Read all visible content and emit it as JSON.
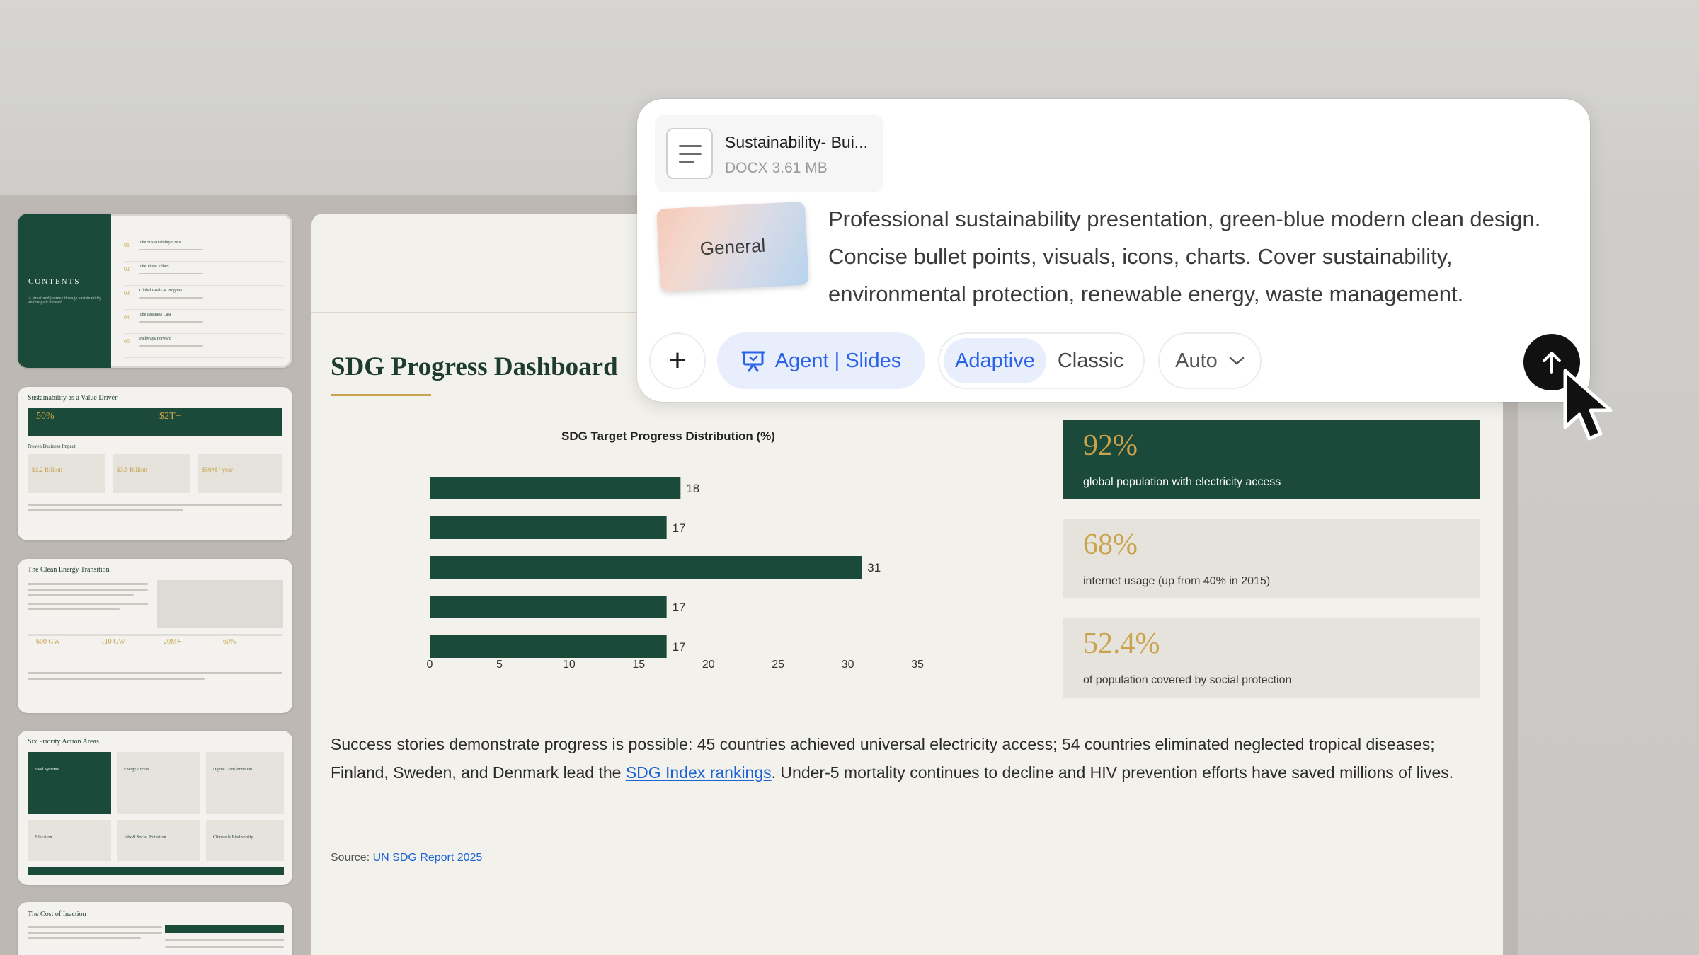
{
  "thumbnails": [
    {
      "title": "CONTENTS",
      "subtitle": "A structured journey through sustainability and its path forward",
      "items": [
        {
          "num": "01",
          "label": "The Sustainability Crisis"
        },
        {
          "num": "02",
          "label": "The Three Pillars"
        },
        {
          "num": "03",
          "label": "Global Goals & Progress"
        },
        {
          "num": "04",
          "label": "The Business Case"
        },
        {
          "num": "05",
          "label": "Pathways Forward"
        }
      ]
    },
    {
      "title": "Sustainability as a Value Driver",
      "stats": [
        "50%",
        "$2T+"
      ],
      "section": "Proven Business Impact",
      "figures": [
        "$1.2 Billion",
        "$3.5 Billion",
        "$50M / year"
      ]
    },
    {
      "title": "The Clean Energy Transition",
      "figures": [
        "600 GW",
        "110 GW",
        "20M+",
        "60%"
      ]
    },
    {
      "title": "Six Priority Action Areas",
      "areas": [
        "Food Systems",
        "Energy Access",
        "Digital Transformation",
        "Education",
        "Jobs & Social Protection",
        "Climate & Biodiversity"
      ]
    },
    {
      "title": "The Cost of Inaction"
    }
  ],
  "slide": {
    "title": "SDG Progress Dashboard",
    "body_parts": {
      "before_link": "Success stories demonstrate progress is possible: 45 countries achieved universal electricity access; 54 countries eliminated neglected tropical diseases; Finland, Sweden, and Denmark lead the ",
      "link": "SDG Index rankings",
      "after_link": ". Under-5 mortality continues to decline and HIV prevention efforts have saved millions of lives."
    },
    "source_label": "Source: ",
    "source_link": "UN SDG Report 2025",
    "stats": [
      {
        "value": "92%",
        "label": "global population with electricity access"
      },
      {
        "value": "68%",
        "label": "internet usage (up from 40% in 2015)"
      },
      {
        "value": "52.4%",
        "label": "of population covered by social protection"
      }
    ]
  },
  "chart_data": {
    "type": "bar",
    "orientation": "horizontal",
    "title": "SDG Target Progress Distribution (%)",
    "categories": [
      "",
      "",
      "",
      "",
      ""
    ],
    "values": [
      18,
      17,
      31,
      17,
      17
    ],
    "xlim": [
      0,
      35
    ],
    "xticks": [
      0,
      5,
      10,
      15,
      20,
      25,
      30,
      35
    ],
    "grid": false,
    "bar_color": "#1b4a3a"
  },
  "prompt_panel": {
    "file": {
      "name": "Sustainability- Bui...",
      "meta": "DOCX 3.61 MB"
    },
    "style_card": "General",
    "prompt": "Professional sustainability presentation, green-blue modern clean design. Concise bullet points, visuals, icons, charts. Cover sustainability, environmental protection, renewable energy, waste management.",
    "plus_label": "+",
    "agent_label": "Agent | Slides",
    "modes": [
      "Adaptive",
      "Classic"
    ],
    "active_mode": "Adaptive",
    "auto_label": "Auto"
  },
  "colors": {
    "brand_green": "#1b4a3a",
    "gold": "#c9a24b",
    "accent_blue": "#2a63e6"
  }
}
